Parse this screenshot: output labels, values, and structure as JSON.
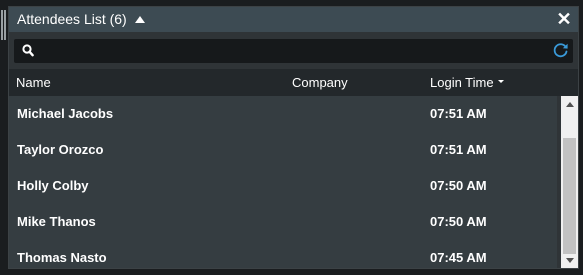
{
  "panel": {
    "title": "Attendees List (6)",
    "close_label": "✕"
  },
  "search": {
    "value": "",
    "placeholder": ""
  },
  "columns": {
    "name": "Name",
    "company": "Company",
    "login_time": "Login Time"
  },
  "rows": [
    {
      "name": "Michael Jacobs",
      "company": "",
      "time": "07:51 AM"
    },
    {
      "name": "Taylor Orozco",
      "company": "",
      "time": "07:51 AM"
    },
    {
      "name": "Holly Colby",
      "company": "",
      "time": "07:50 AM"
    },
    {
      "name": "Mike Thanos",
      "company": "",
      "time": "07:50 AM"
    },
    {
      "name": "Thomas Nasto",
      "company": "",
      "time": "07:45 AM"
    }
  ],
  "colors": {
    "title_bar": "#3d4b53",
    "row_background": "#353d41",
    "header_background": "#23282b",
    "refresh_accent": "#3a9ad9"
  },
  "icons": {
    "collapse": "caret-up-icon",
    "close": "close-icon",
    "search": "search-icon",
    "refresh": "refresh-icon",
    "sort": "sort-desc-icon"
  }
}
